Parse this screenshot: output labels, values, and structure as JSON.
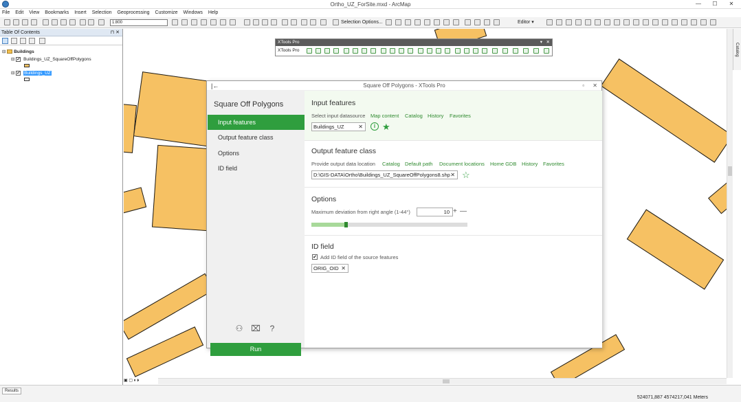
{
  "window": {
    "title": "Ortho_UZ_ForSite.mxd - ArcMap",
    "min": "—",
    "max": "☐",
    "close": "✕"
  },
  "menu": [
    "File",
    "Edit",
    "View",
    "Bookmarks",
    "Insert",
    "Selection",
    "Geoprocessing",
    "Customize",
    "Windows",
    "Help"
  ],
  "toolbar": {
    "scale": "1:800",
    "selection_options": "Selection Options...",
    "editor": "Editor ▾"
  },
  "toc": {
    "title": "Table Of Contents",
    "pin": "⊓ ✕",
    "group": "Buildings",
    "layers": [
      "Buildings_UZ_SquareOffPolygons",
      "Buildings_UZ"
    ]
  },
  "xtools_bar": {
    "title": "XTools Pro",
    "label": "XTools Pro",
    "pin": "▾",
    "close": "✕"
  },
  "dialog": {
    "title": "Square Off Polygons - XTools Pro",
    "back_icon": "|←",
    "win_buttons": [
      "▫",
      "✕"
    ],
    "left_title": "Square Off Polygons",
    "nav": [
      "Input features",
      "Output feature class",
      "Options",
      "ID field"
    ],
    "run": "Run",
    "input": {
      "heading": "Input features",
      "hint": "Select input datasource",
      "links": [
        "Map content",
        "Catalog",
        "History",
        "Favorites"
      ],
      "value": "Buildings_UZ",
      "clear": "✕",
      "info_icon": "i",
      "star": "★"
    },
    "output": {
      "heading": "Output feature class",
      "hint": "Provide output data location",
      "links": [
        "Catalog",
        "Default path",
        "Document locations",
        "Home GDB",
        "History",
        "Favorites"
      ],
      "value": "D:\\GIS-DATA\\Ortho\\Buildings_UZ_SquareOffPolygons8.shp",
      "clear": "✕",
      "star": "☆"
    },
    "options": {
      "heading": "Options",
      "label": "Maximum deviation from right angle (1-44°)",
      "value": "10",
      "plus": "+",
      "minus": "—",
      "slider_fraction": 0.22
    },
    "idfield": {
      "heading": "ID field",
      "check_label": "Add ID field of the source features",
      "checked": "✔",
      "value": "ORIG_OID",
      "clear": "✕"
    }
  },
  "catalog_tab": "Catalog",
  "results_tab": "Results",
  "coords": "524071,887  4574217,041 Meters",
  "colors": {
    "accent": "#2f9e3e",
    "building_fill": "#f6c163"
  }
}
